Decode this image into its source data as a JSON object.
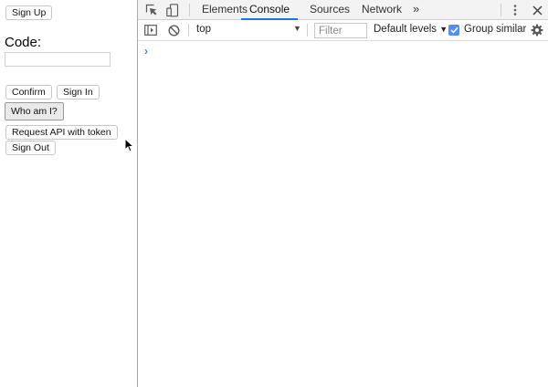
{
  "page": {
    "signup_label": "Sign Up",
    "code_label": "Code:",
    "code_value": "",
    "confirm_label": "Confirm",
    "signin_label": "Sign In",
    "whoami_label": "Who am I?",
    "request_api_label": "Request API with token",
    "signout_label": "Sign Out"
  },
  "devtools": {
    "tabs": [
      {
        "label": "Elements",
        "active": false
      },
      {
        "label": "Console",
        "active": true
      },
      {
        "label": "Sources",
        "active": false
      },
      {
        "label": "Network",
        "active": false
      }
    ],
    "more_tabs_glyph": "»",
    "toolbar": {
      "context": "top",
      "filter_placeholder": "Filter",
      "levels": "Default levels",
      "group_similar_label": "Group similar",
      "group_similar_checked": true
    },
    "prompt_glyph": "›"
  },
  "colors": {
    "active_tab": "#1a73e8",
    "checkbox": "#4e8ef7",
    "prompt": "#367cf1"
  },
  "icons": [
    "inspect-element-icon",
    "device-toolbar-icon",
    "kebab-menu-icon",
    "close-icon",
    "console-sidebar-icon",
    "clear-console-icon",
    "dropdown-arrow-icon",
    "settings-gear-icon",
    "mouse-cursor-icon"
  ]
}
